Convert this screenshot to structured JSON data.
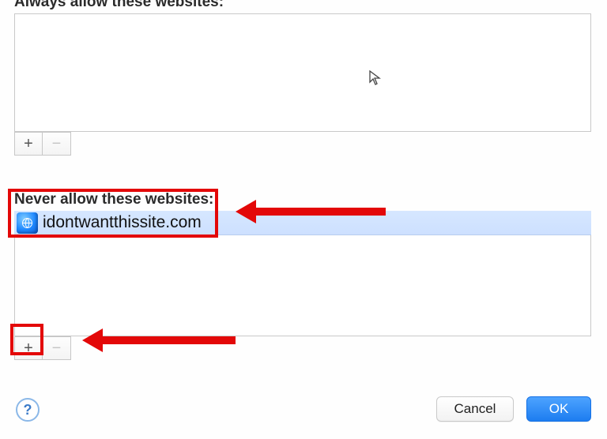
{
  "always_section": {
    "label": "Always allow these websites:",
    "items": []
  },
  "never_section": {
    "label": "Never allow these websites:",
    "items": [
      {
        "icon": "globe-icon",
        "site": "idontwantthissite.com"
      }
    ]
  },
  "buttons": {
    "add": "+",
    "remove": "−",
    "cancel": "Cancel",
    "ok": "OK",
    "help": "?"
  }
}
